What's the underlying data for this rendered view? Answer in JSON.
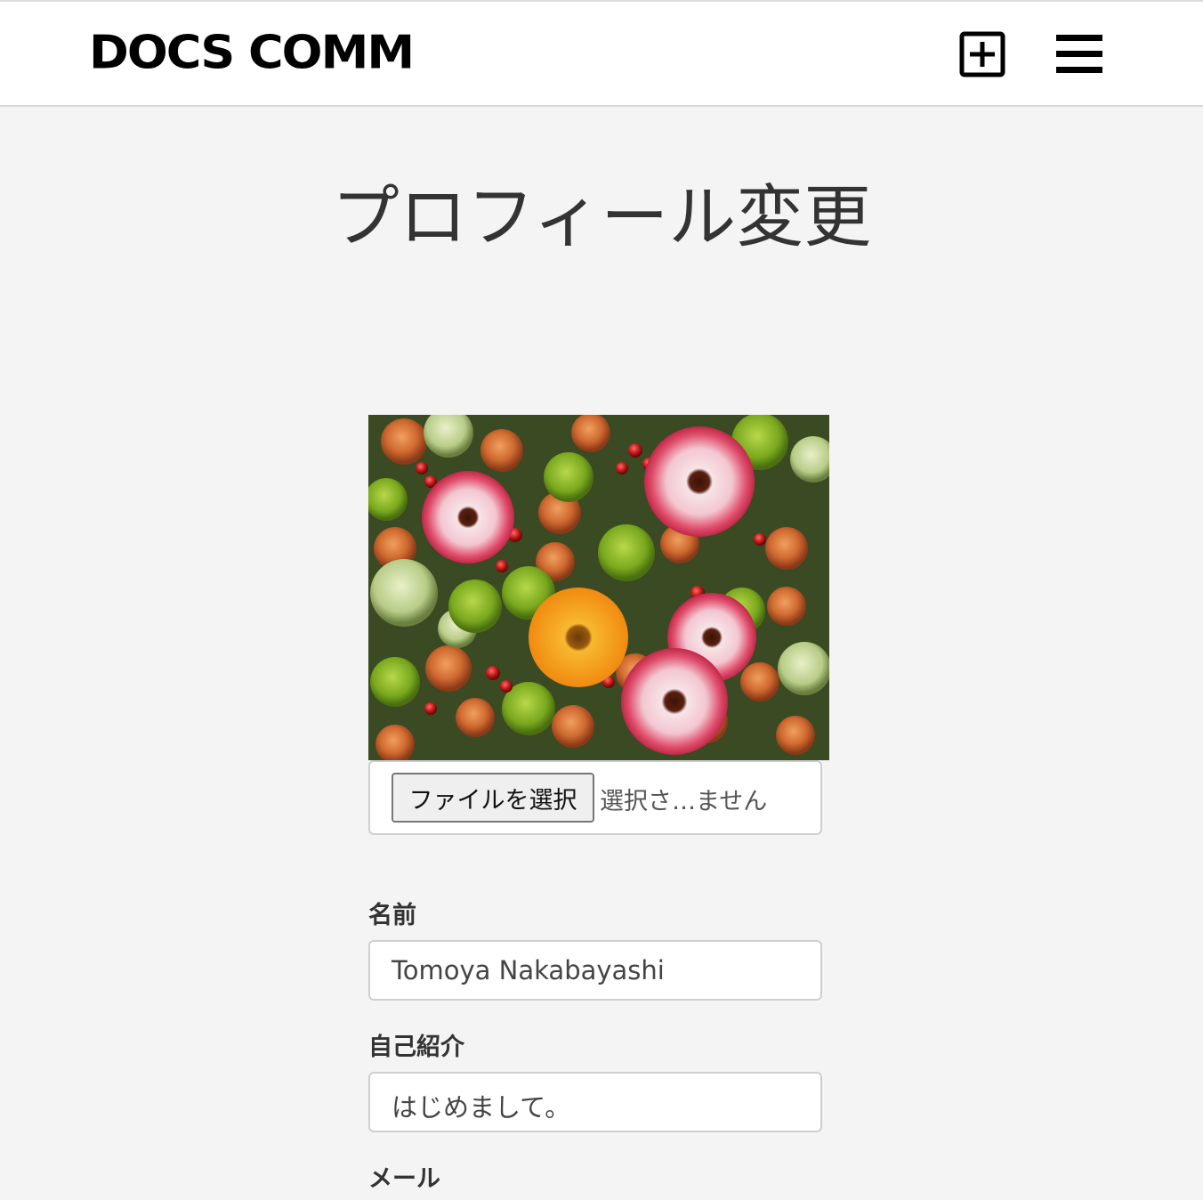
{
  "header": {
    "logo": "DOCS COMM",
    "new_post_icon": "plus-square-icon",
    "menu_icon": "hamburger-menu-icon"
  },
  "page": {
    "title": "プロフィール変更"
  },
  "avatar": {
    "description_icon": "flower-bouquet-image"
  },
  "file_input": {
    "button_label": "ファイルを選択",
    "status": "選択さ…ません"
  },
  "form": {
    "name_label": "名前",
    "name_value": "Tomoya Nakabayashi",
    "bio_label": "自己紹介",
    "bio_value": "はじめまして。",
    "email_label": "メール"
  },
  "colors": {
    "background": "#f4f4f4",
    "header_bg": "#ffffff",
    "text": "#333333"
  }
}
